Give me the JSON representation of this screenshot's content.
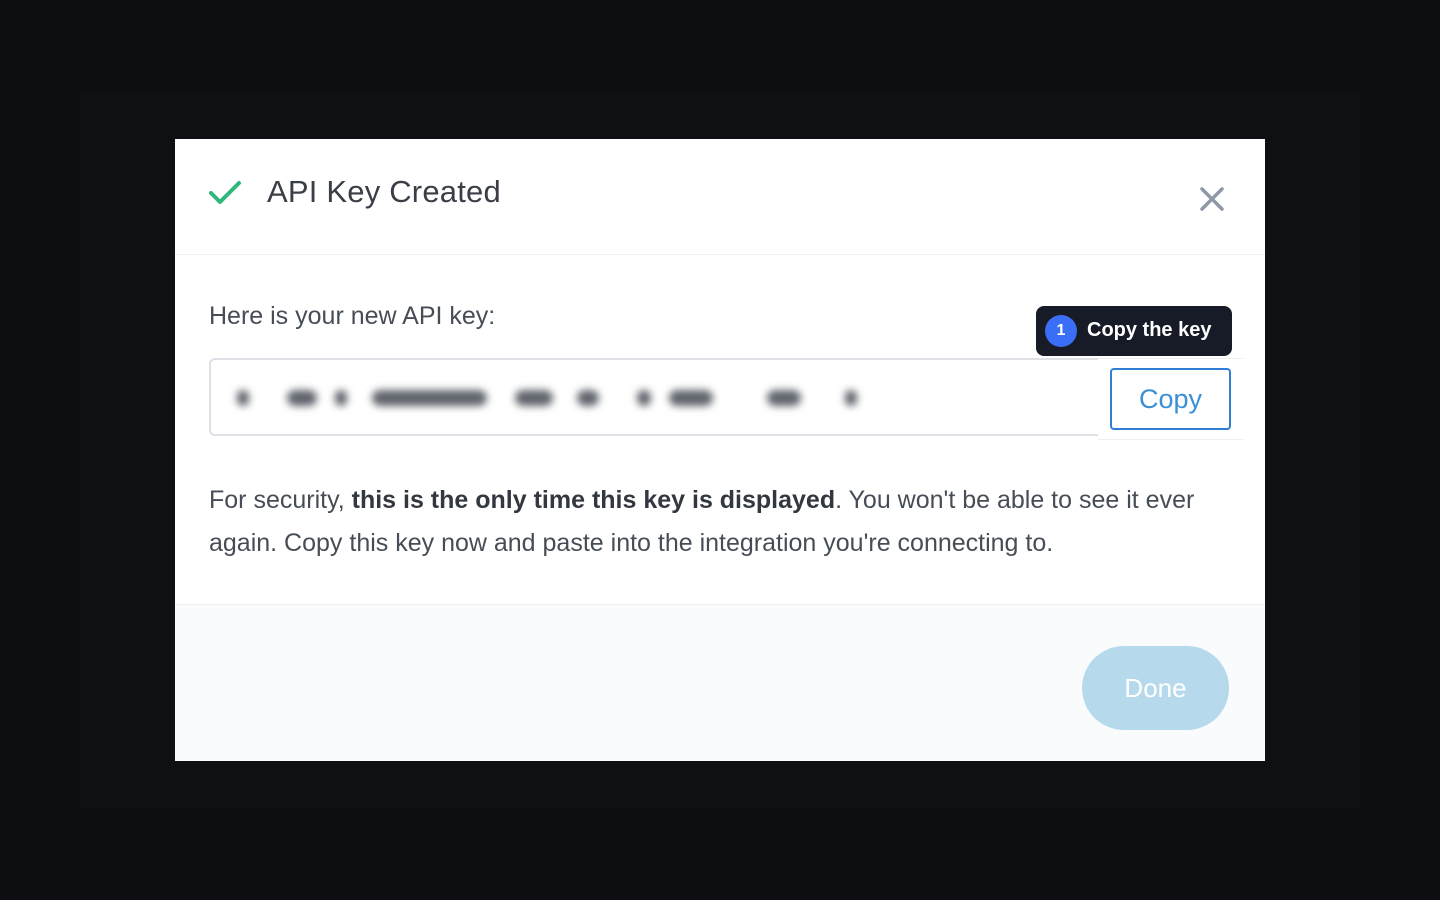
{
  "modal": {
    "title": "API Key Created",
    "close_icon": "close-icon",
    "success_icon": "check-icon"
  },
  "key_section": {
    "label": "Here is your new API key:",
    "key_value_state": "blurred",
    "copy_label": "Copy"
  },
  "tooltip": {
    "step": "1",
    "text": "Copy the key"
  },
  "security_notice": {
    "prefix": "For security, ",
    "bold": "this is the only time this key is displayed",
    "suffix": ". You won't be able to see it ever again. Copy this key now and paste into the integration you're connecting to."
  },
  "footer": {
    "done_label": "Done"
  },
  "colors": {
    "backdrop": "#0d0e11",
    "success_green": "#2fb87c",
    "copy_blue": "#2f7fd6",
    "tooltip_bg": "#161b27",
    "badge_blue": "#3b6ef6",
    "done_disabled": "#b7d9ec"
  }
}
